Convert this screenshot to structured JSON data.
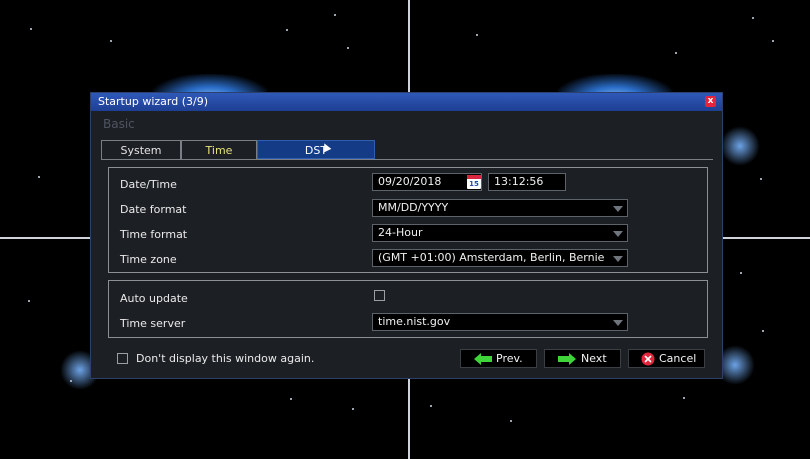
{
  "dialog": {
    "title": "Startup wizard (3/9)",
    "close_label": "x",
    "section_title": "Basic"
  },
  "tabs": [
    {
      "label": "System"
    },
    {
      "label": "Time"
    },
    {
      "label": "DST"
    }
  ],
  "fields": {
    "datetime": {
      "label": "Date/Time",
      "date": "09/20/2018",
      "calendar_day": "15",
      "time": "13:12:56"
    },
    "date_format": {
      "label": "Date format",
      "value": "MM/DD/YYYY"
    },
    "time_format": {
      "label": "Time format",
      "value": "24-Hour"
    },
    "time_zone": {
      "label": "Time zone",
      "value": "(GMT +01:00) Amsterdam, Berlin, Bernie"
    },
    "auto_update": {
      "label": "Auto update",
      "checked": false
    },
    "time_server": {
      "label": "Time server",
      "value": "time.nist.gov"
    }
  },
  "footer": {
    "dont_display_label": "Don't display this window again.",
    "prev_label": "Prev.",
    "next_label": "Next",
    "cancel_label": "Cancel"
  },
  "colors": {
    "titlebar": "#2a4fa8",
    "active_tab": "#133b86",
    "time_tab_text": "#e7e27a",
    "arrow_green": "#3fd43a",
    "cancel_red": "#e2263c"
  },
  "icons": [
    "calendar-icon",
    "close-icon",
    "arrow-left-icon",
    "arrow-right-icon",
    "cancel-icon",
    "dropdown-arrow-icon"
  ]
}
